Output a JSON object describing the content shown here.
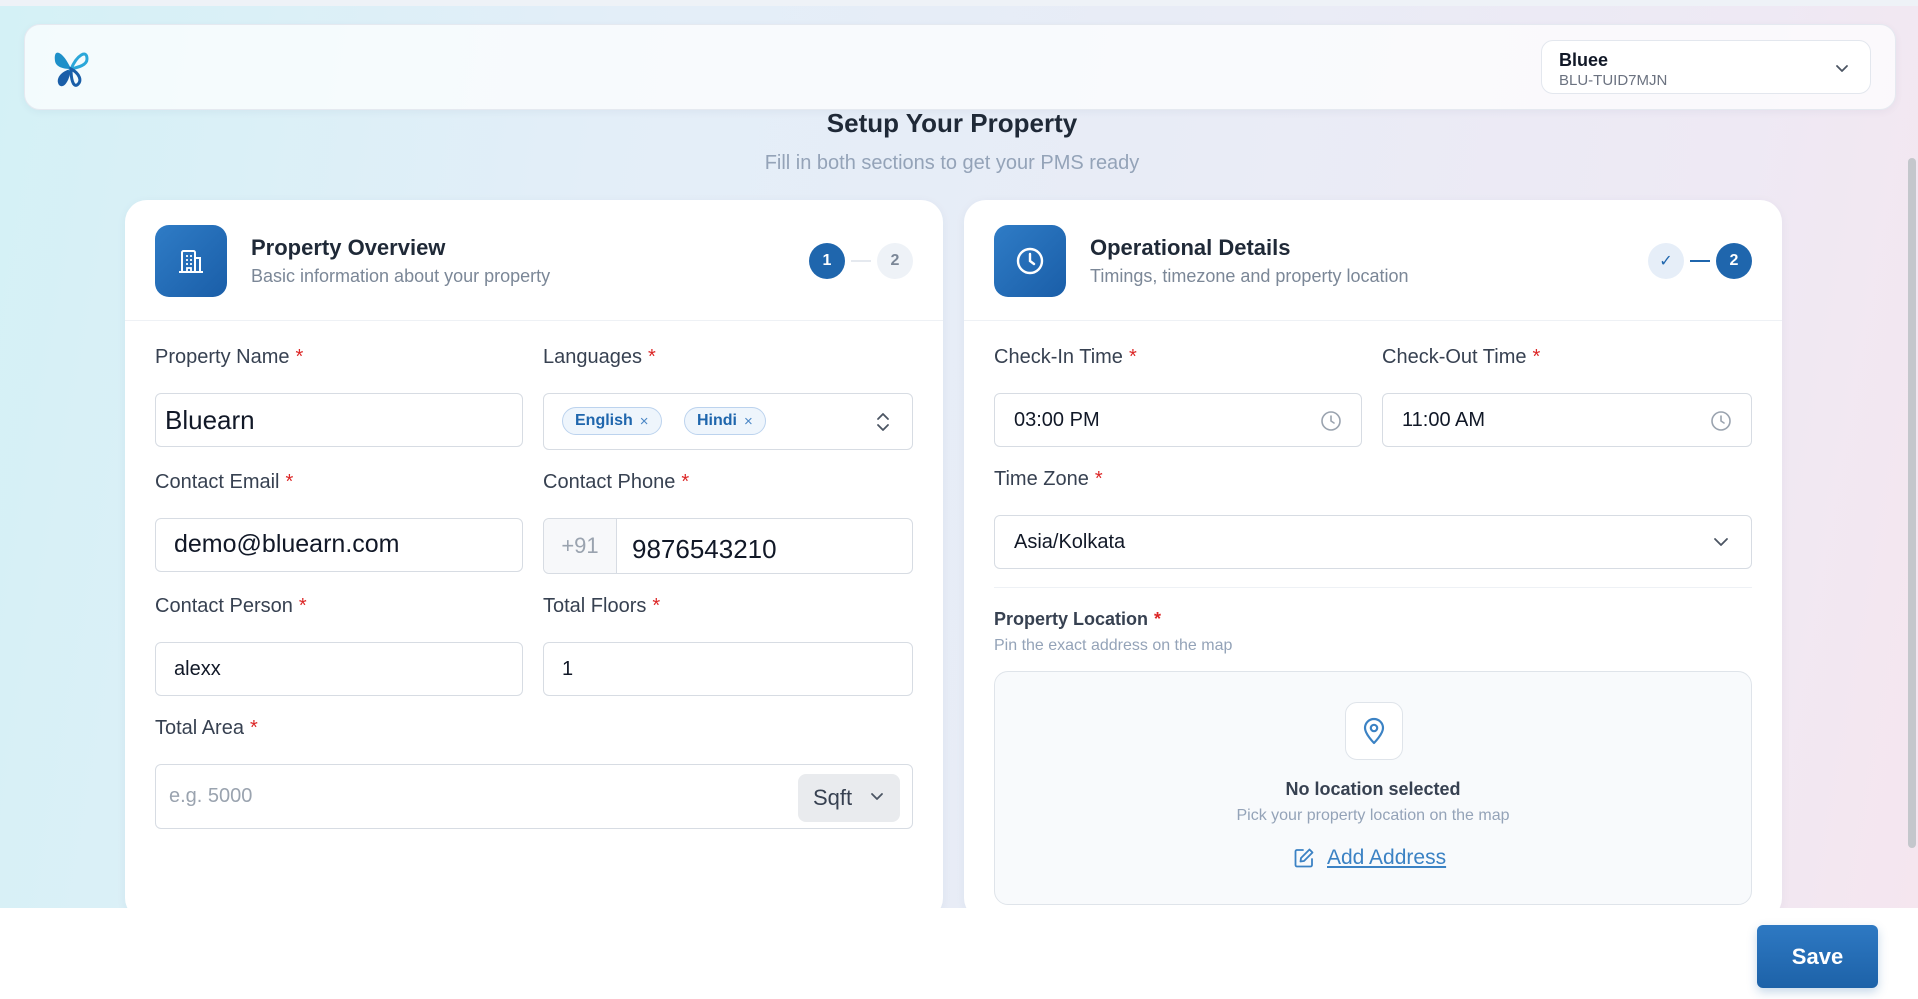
{
  "header": {
    "account_name": "Bluee",
    "account_code": "BLU-TUID7MJN"
  },
  "page": {
    "title": "Setup Your Property",
    "subtitle": "Fill in both sections to get your PMS ready"
  },
  "overview": {
    "title": "Property Overview",
    "subtitle": "Basic information about your property",
    "steps": [
      "1",
      "2"
    ],
    "property_name": {
      "label": "Property Name",
      "value": "Bluearn"
    },
    "languages": {
      "label": "Languages",
      "chips": [
        "English",
        "Hindi"
      ],
      "remove_glyph": "×"
    },
    "contact_email": {
      "label": "Contact Email",
      "value": "demo@bluearn.com"
    },
    "contact_phone": {
      "label": "Contact Phone",
      "prefix": "+91",
      "value": "9876543210"
    },
    "contact_person": {
      "label": "Contact Person",
      "value": "alexx"
    },
    "total_floors": {
      "label": "Total Floors",
      "value": "1"
    },
    "total_area": {
      "label": "Total Area",
      "placeholder": "e.g. 5000",
      "unit": "Sqft"
    },
    "required_mark": "*"
  },
  "operational": {
    "title": "Operational Details",
    "subtitle": "Timings, timezone and property location",
    "steps": [
      "✓",
      "2"
    ],
    "check_in": {
      "label": "Check-In Time",
      "value": "03:00 PM"
    },
    "check_out": {
      "label": "Check-Out Time",
      "value": "11:00 AM"
    },
    "time_zone": {
      "label": "Time Zone",
      "value": "Asia/Kolkata"
    },
    "location": {
      "title": "Property Location",
      "subtitle": "Pin the exact address on the map",
      "empty_title": "No location selected",
      "empty_subtitle": "Pick your property location on the map",
      "add_label": "Add Address"
    }
  },
  "footer": {
    "save_label": "Save"
  },
  "colors": {
    "primary": "#1f66ad",
    "required": "#dc2626"
  },
  "icons": [
    "butterfly-logo-icon",
    "chevron-down-icon",
    "building-icon",
    "clock-icon",
    "check-icon",
    "close-icon",
    "chevron-up-down-icon",
    "map-pin-icon",
    "edit-icon"
  ]
}
